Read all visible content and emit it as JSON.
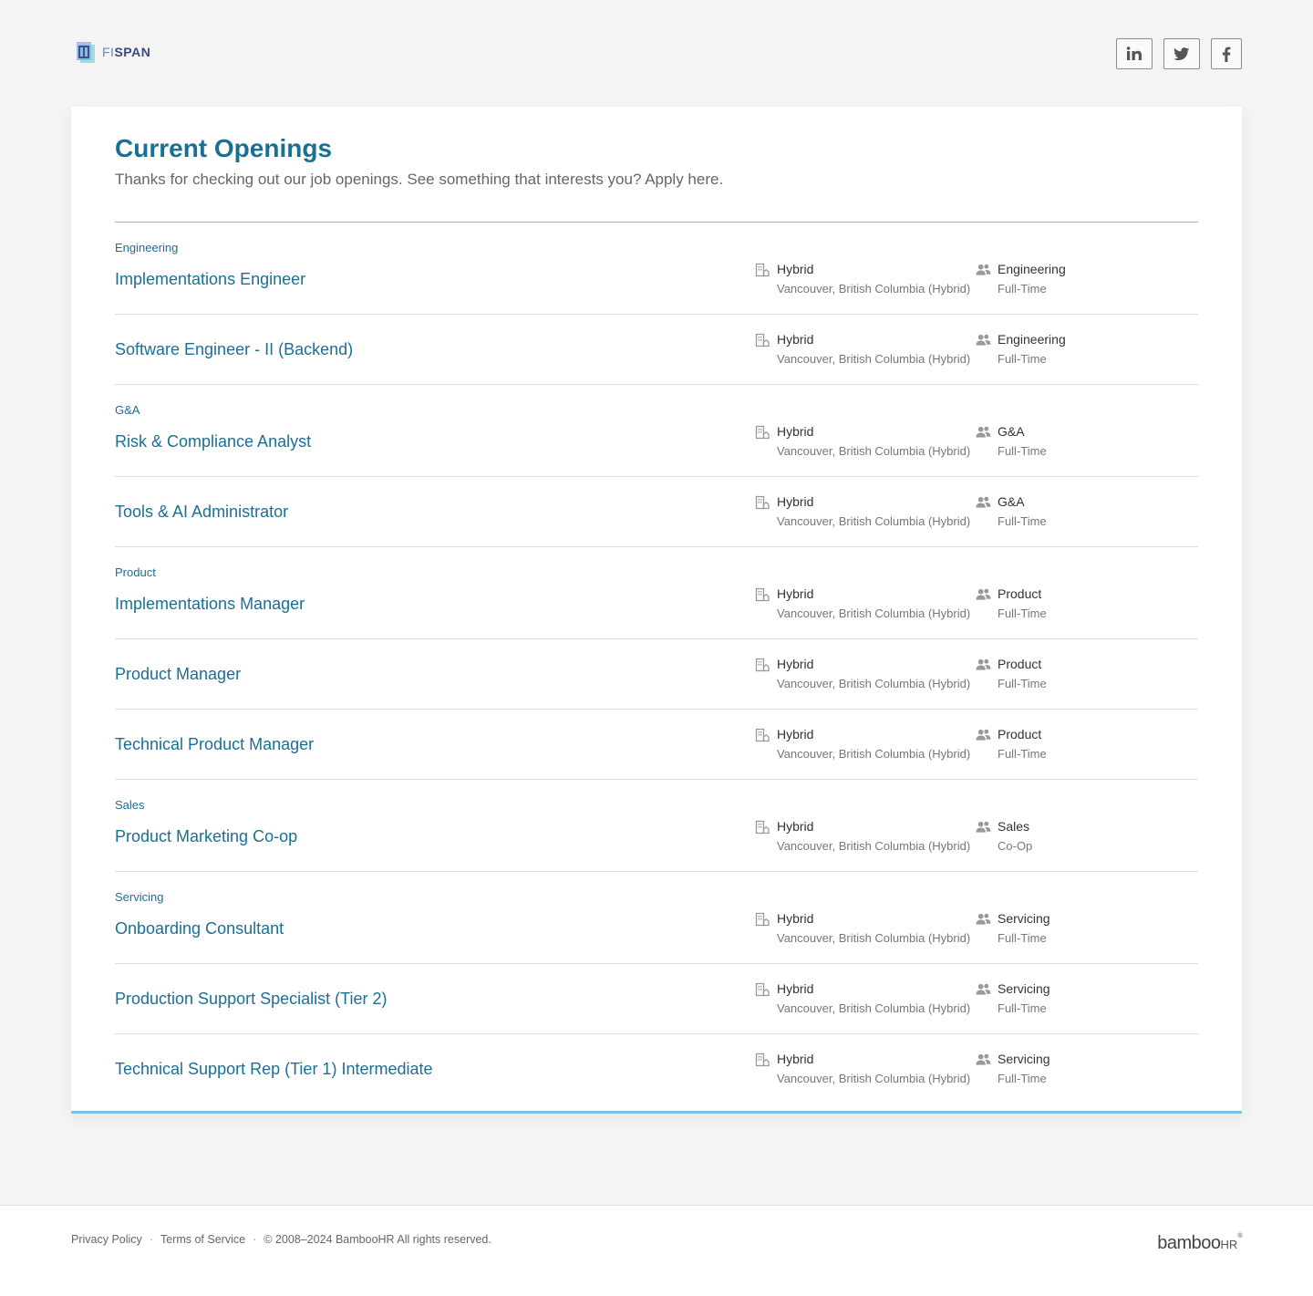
{
  "header": {
    "logo_prefix": "FI",
    "logo_rest": "SPAN",
    "social": [
      {
        "name": "linkedin",
        "icon": "linkedin-icon",
        "glyph": "in"
      },
      {
        "name": "twitter",
        "icon": "twitter-icon",
        "glyph": "bird"
      },
      {
        "name": "facebook",
        "icon": "facebook-icon",
        "glyph": "f"
      }
    ]
  },
  "main": {
    "title": "Current Openings",
    "subtitle": "Thanks for checking out our job openings. See something that interests you? Apply here.",
    "jobs": [
      {
        "department_header": "Engineering",
        "title": "Implementations Engineer",
        "location_type": "Hybrid",
        "location": "Vancouver, British Columbia (Hybrid)",
        "department": "Engineering",
        "employment": "Full-Time"
      },
      {
        "department_header": "",
        "title": "Software Engineer - II (Backend)",
        "location_type": "Hybrid",
        "location": "Vancouver, British Columbia (Hybrid)",
        "department": "Engineering",
        "employment": "Full-Time"
      },
      {
        "department_header": "G&A",
        "title": "Risk & Compliance Analyst",
        "location_type": "Hybrid",
        "location": "Vancouver, British Columbia (Hybrid)",
        "department": "G&A",
        "employment": "Full-Time"
      },
      {
        "department_header": "",
        "title": "Tools & AI Administrator",
        "location_type": "Hybrid",
        "location": "Vancouver, British Columbia (Hybrid)",
        "department": "G&A",
        "employment": "Full-Time"
      },
      {
        "department_header": "Product",
        "title": "Implementations Manager",
        "location_type": "Hybrid",
        "location": "Vancouver, British Columbia (Hybrid)",
        "department": "Product",
        "employment": "Full-Time"
      },
      {
        "department_header": "",
        "title": "Product Manager",
        "location_type": "Hybrid",
        "location": "Vancouver, British Columbia (Hybrid)",
        "department": "Product",
        "employment": "Full-Time"
      },
      {
        "department_header": "",
        "title": "Technical Product Manager",
        "location_type": "Hybrid",
        "location": "Vancouver, British Columbia (Hybrid)",
        "department": "Product",
        "employment": "Full-Time"
      },
      {
        "department_header": "Sales",
        "title": "Product Marketing Co-op",
        "location_type": "Hybrid",
        "location": "Vancouver, British Columbia (Hybrid)",
        "department": "Sales",
        "employment": "Co-Op"
      },
      {
        "department_header": "Servicing",
        "title": "Onboarding Consultant",
        "location_type": "Hybrid",
        "location": "Vancouver, British Columbia (Hybrid)",
        "department": "Servicing",
        "employment": "Full-Time"
      },
      {
        "department_header": "",
        "title": "Production Support Specialist (Tier 2)",
        "location_type": "Hybrid",
        "location": "Vancouver, British Columbia (Hybrid)",
        "department": "Servicing",
        "employment": "Full-Time"
      },
      {
        "department_header": "",
        "title": "Technical Support Rep (Tier 1) Intermediate",
        "location_type": "Hybrid",
        "location": "Vancouver, British Columbia (Hybrid)",
        "department": "Servicing",
        "employment": "Full-Time"
      }
    ]
  },
  "footer": {
    "privacy": "Privacy Policy",
    "terms": "Terms of Service",
    "separator": "·",
    "copyright": "© 2008–2024 BambooHR All rights reserved.",
    "brand_main": "bamboo",
    "brand_hr": "HR",
    "brand_reg": "®"
  },
  "colors": {
    "accent": "#1a6f94",
    "card_border": "#7cc0e2",
    "background": "#f4f4f4"
  }
}
